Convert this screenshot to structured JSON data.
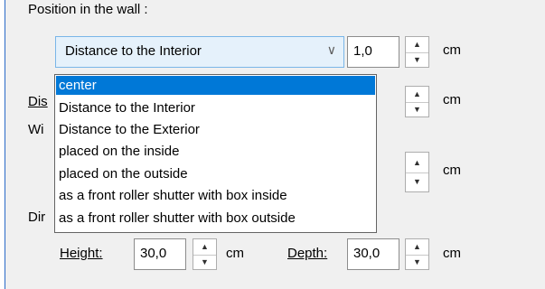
{
  "position_label": "Position in the wall :",
  "combo": {
    "selected": "Distance to the Interior"
  },
  "position_value": "1,0",
  "unit_cm": "cm",
  "hidden_labels": {
    "dis": "Dis",
    "wi": "Wi",
    "dir": "Dir"
  },
  "dropdown_options": [
    "center",
    "Distance to the Interior",
    "Distance to the Exterior",
    "placed on the inside",
    "placed on the outside",
    "as a front roller shutter with box inside",
    "as a front roller shutter with box outside"
  ],
  "box": {
    "height_label": "Height:",
    "height_value": "30,0",
    "depth_label": "Depth:",
    "depth_value": "30,0"
  }
}
